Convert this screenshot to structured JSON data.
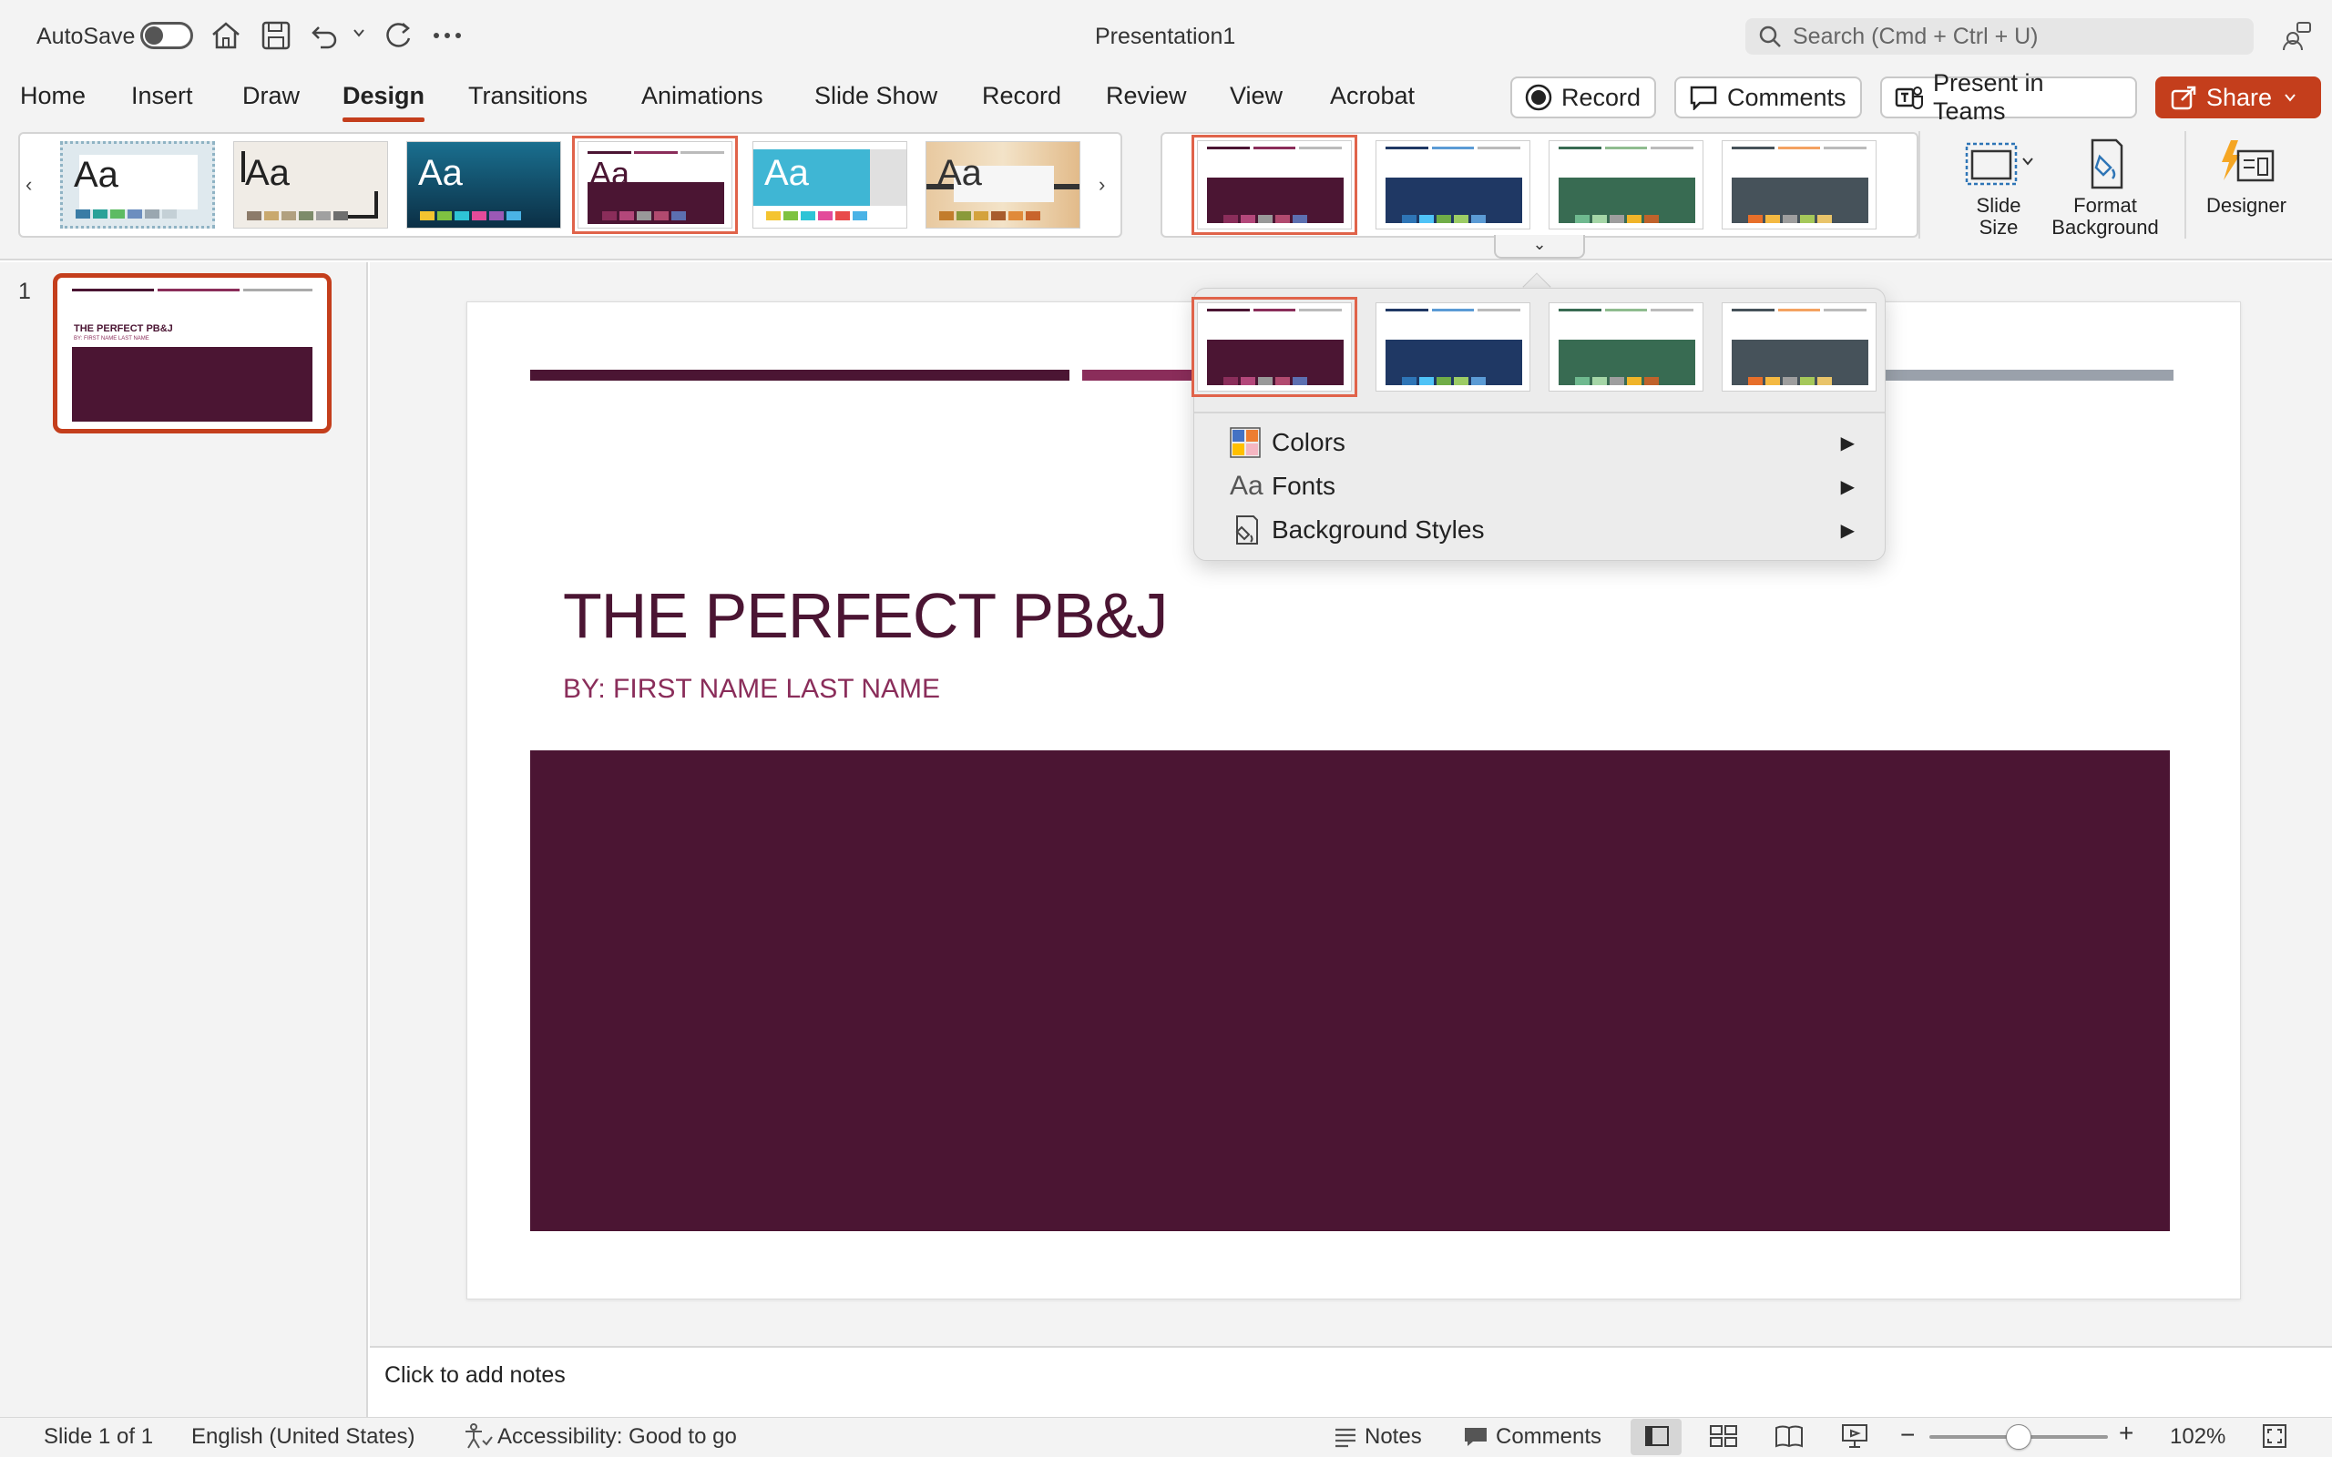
{
  "titlebar": {
    "autosave_label": "AutoSave",
    "doc_title": "Presentation1",
    "search_placeholder": "Search (Cmd + Ctrl + U)"
  },
  "tabs": [
    "Home",
    "Insert",
    "Draw",
    "Design",
    "Transitions",
    "Animations",
    "Slide Show",
    "Record",
    "Review",
    "View",
    "Acrobat"
  ],
  "active_tab": "Design",
  "ribbon_buttons": {
    "record": "Record",
    "comments": "Comments",
    "present": "Present in Teams",
    "share": "Share"
  },
  "tools": {
    "slide_size_1": "Slide",
    "slide_size_2": "Size",
    "format_bg_1": "Format",
    "format_bg_2": "Background",
    "designer": "Designer"
  },
  "theme_aa": [
    "Aa",
    "Aa",
    "Aa",
    "Aa",
    "Aa",
    "Aa"
  ],
  "slide_panel": {
    "number": "1",
    "thumb_title": "THE PERFECT PB&J",
    "thumb_subtitle": "BY: FIRST NAME LAST NAME"
  },
  "slide": {
    "title": "THE PERFECT PB&J",
    "subtitle": "BY: FIRST NAME LAST NAME"
  },
  "dropdown": {
    "items": [
      "Colors",
      "Fonts",
      "Background Styles"
    ]
  },
  "notes_placeholder": "Click to add notes",
  "statusbar": {
    "slide_info": "Slide 1 of 1",
    "language": "English (United States)",
    "accessibility": "Accessibility: Good to go",
    "notes": "Notes",
    "comments": "Comments",
    "zoom": "102%"
  },
  "zoom_level": 1.02,
  "colors": {
    "accent": "#c43e1c",
    "plum": "#4b1533",
    "plum_light": "#8a2d5a",
    "navy": "#1f3864",
    "green": "#386b52",
    "slate": "#46525a"
  }
}
